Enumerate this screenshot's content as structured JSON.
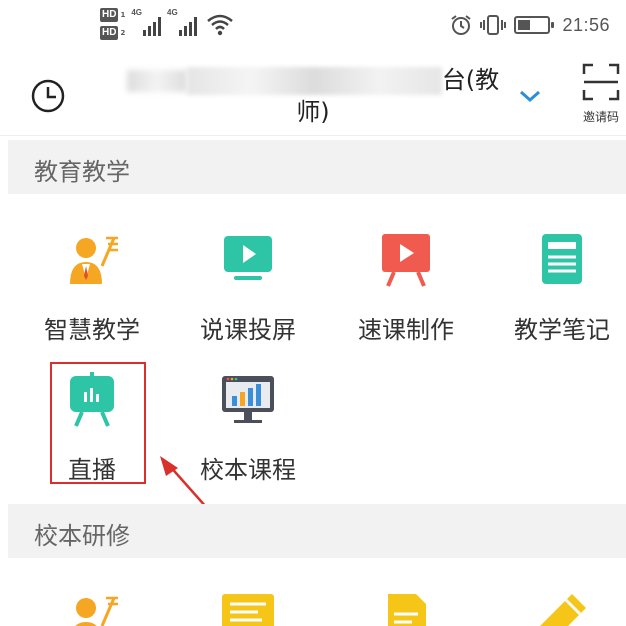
{
  "status_bar": {
    "hd1": "HD",
    "hd1_sub": "1",
    "hd2": "HD",
    "hd2_sub": "2",
    "sim1_net": "4G",
    "sim2_net": "4G",
    "battery_level": 0.35,
    "time": "21:56",
    "icons": [
      "alarm-icon",
      "vibrate-icon",
      "battery-icon",
      "wifi-icon",
      "signal-icon"
    ]
  },
  "header": {
    "title_visible_end": "台(教",
    "title_line2": "师)",
    "scan_label": "邀请码"
  },
  "sections": [
    {
      "title": "教育教学",
      "items": [
        {
          "label": "智慧教学",
          "icon": "teacher-icon",
          "color": "#f5a623"
        },
        {
          "label": "说课投屏",
          "icon": "screen-play-icon",
          "color": "#2ec4a6"
        },
        {
          "label": "速课制作",
          "icon": "video-board-icon",
          "color": "#f05a4f"
        },
        {
          "label": "教学笔记",
          "icon": "notes-icon",
          "color": "#2ec4a6"
        },
        {
          "label": "直播",
          "icon": "live-board-icon",
          "color": "#2ec4a6"
        },
        {
          "label": "校本课程",
          "icon": "monitor-chart-icon",
          "color": "#3b8fd9"
        }
      ]
    },
    {
      "title": "校本研修",
      "items": [
        {
          "label": "",
          "icon": "teacher-icon",
          "color": "#f5a623"
        },
        {
          "label": "",
          "icon": "document-icon",
          "color": "#f5c518"
        },
        {
          "label": "",
          "icon": "file-icon",
          "color": "#f5c518"
        },
        {
          "label": "",
          "icon": "pencil-icon",
          "color": "#f5c518"
        }
      ]
    }
  ],
  "colors": {
    "highlight": "#d9302b",
    "accent": "#2a8fd6",
    "section_bg": "#f2f2f2"
  }
}
